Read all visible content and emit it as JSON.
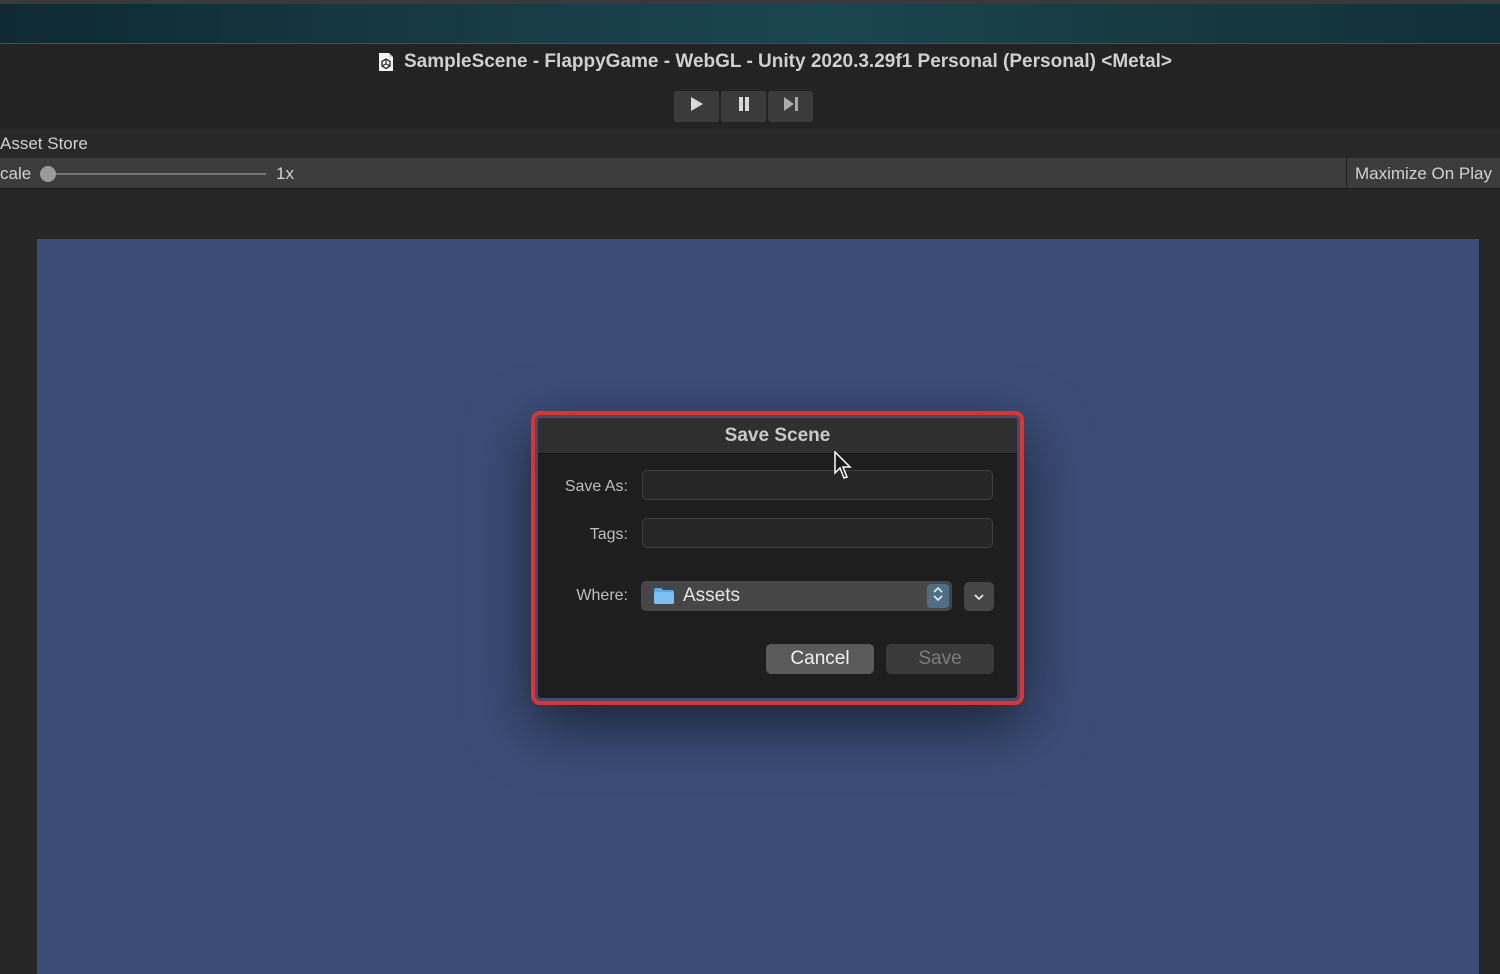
{
  "window": {
    "title": "SampleScene - FlappyGame - WebGL - Unity 2020.3.29f1 Personal (Personal) <Metal>"
  },
  "toolbar": {
    "play_icon": "play-icon",
    "pause_icon": "pause-icon",
    "step_icon": "step-icon"
  },
  "tab": {
    "label": "Asset Store"
  },
  "game_toolbar": {
    "scale_label": "cale",
    "scale_value": "1x",
    "scale_slider_fraction": 0.0,
    "maximize_label": "Maximize On Play"
  },
  "dialog": {
    "title": "Save Scene",
    "save_as_label": "Save As:",
    "save_as_value": "",
    "tags_label": "Tags:",
    "tags_value": "",
    "where_label": "Where:",
    "where_value": "Assets",
    "cancel_label": "Cancel",
    "save_label": "Save"
  },
  "colors": {
    "highlight": "#e2332b",
    "game_canvas": "#3b4d77",
    "stepper_accent": "#4f6f85"
  }
}
